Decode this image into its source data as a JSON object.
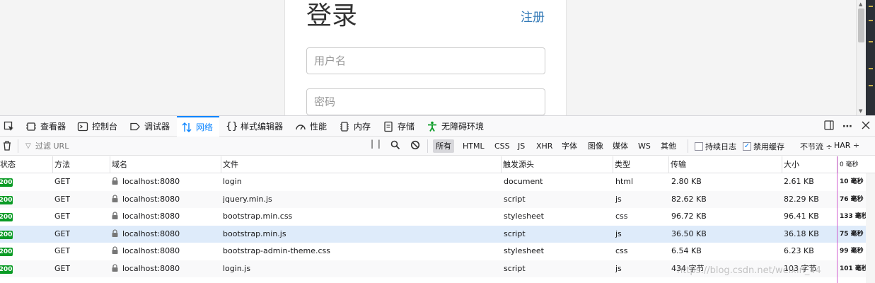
{
  "page": {
    "title": "登录",
    "register_link": "注册",
    "username_placeholder": "用户名",
    "password_placeholder": "密码"
  },
  "devtools": {
    "tabs": [
      {
        "label": "查看器",
        "icon": "inspector-icon"
      },
      {
        "label": "控制台",
        "icon": "console-icon"
      },
      {
        "label": "调试器",
        "icon": "debugger-icon"
      },
      {
        "label": "网络",
        "icon": "network-icon",
        "active": true
      },
      {
        "label": "样式编辑器",
        "icon": "style-editor-icon"
      },
      {
        "label": "性能",
        "icon": "performance-icon"
      },
      {
        "label": "内存",
        "icon": "memory-icon"
      },
      {
        "label": "存储",
        "icon": "storage-icon"
      },
      {
        "label": "无障碍环境",
        "icon": "accessibility-icon"
      }
    ],
    "filter": {
      "url_placeholder": "过滤 URL",
      "pause_label": "| |",
      "types": [
        "所有",
        "HTML",
        "CSS",
        "JS",
        "XHR",
        "字体",
        "图像",
        "媒体",
        "WS",
        "其他"
      ],
      "active_type": "所有",
      "persist_logs": "持续日志",
      "persist_logs_checked": false,
      "disable_cache": "禁用缓存",
      "disable_cache_checked": true,
      "throttle": "不节流 ÷",
      "har": "HAR ÷"
    },
    "columns": [
      "状态",
      "方法",
      "域名",
      "文件",
      "触发源头",
      "类型",
      "传输",
      "大小",
      "0 毫秒"
    ],
    "requests": [
      {
        "status": "200",
        "method": "GET",
        "domain": "localhost:8080",
        "file": "login",
        "cause": "document",
        "type": "html",
        "transferred": "2.80 KB",
        "size": "2.61 KB",
        "time": "10 毫秒"
      },
      {
        "status": "200",
        "method": "GET",
        "domain": "localhost:8080",
        "file": "jquery.min.js",
        "cause": "script",
        "type": "js",
        "transferred": "82.62 KB",
        "size": "82.29 KB",
        "time": "76 毫秒"
      },
      {
        "status": "200",
        "method": "GET",
        "domain": "localhost:8080",
        "file": "bootstrap.min.css",
        "cause": "stylesheet",
        "type": "css",
        "transferred": "96.72 KB",
        "size": "96.41 KB",
        "time": "133 毫秒"
      },
      {
        "status": "200",
        "method": "GET",
        "domain": "localhost:8080",
        "file": "bootstrap.min.js",
        "cause": "script",
        "type": "js",
        "transferred": "36.50 KB",
        "size": "36.18 KB",
        "time": "75 毫秒",
        "selected": true
      },
      {
        "status": "200",
        "method": "GET",
        "domain": "localhost:8080",
        "file": "bootstrap-admin-theme.css",
        "cause": "stylesheet",
        "type": "css",
        "transferred": "6.54 KB",
        "size": "6.23 KB",
        "time": "99 毫秒"
      },
      {
        "status": "200",
        "method": "GET",
        "domain": "localhost:8080",
        "file": "login.js",
        "cause": "script",
        "type": "js",
        "transferred": "434 字节",
        "size": "103 字节",
        "time": "101 毫秒"
      }
    ],
    "watermark": "https://blog.csdn.net/weixin_44"
  },
  "colors": {
    "accent": "#0a84ff",
    "status_ok": "#0a9b25",
    "link": "#337ab7",
    "selected_row": "#deebfa"
  }
}
